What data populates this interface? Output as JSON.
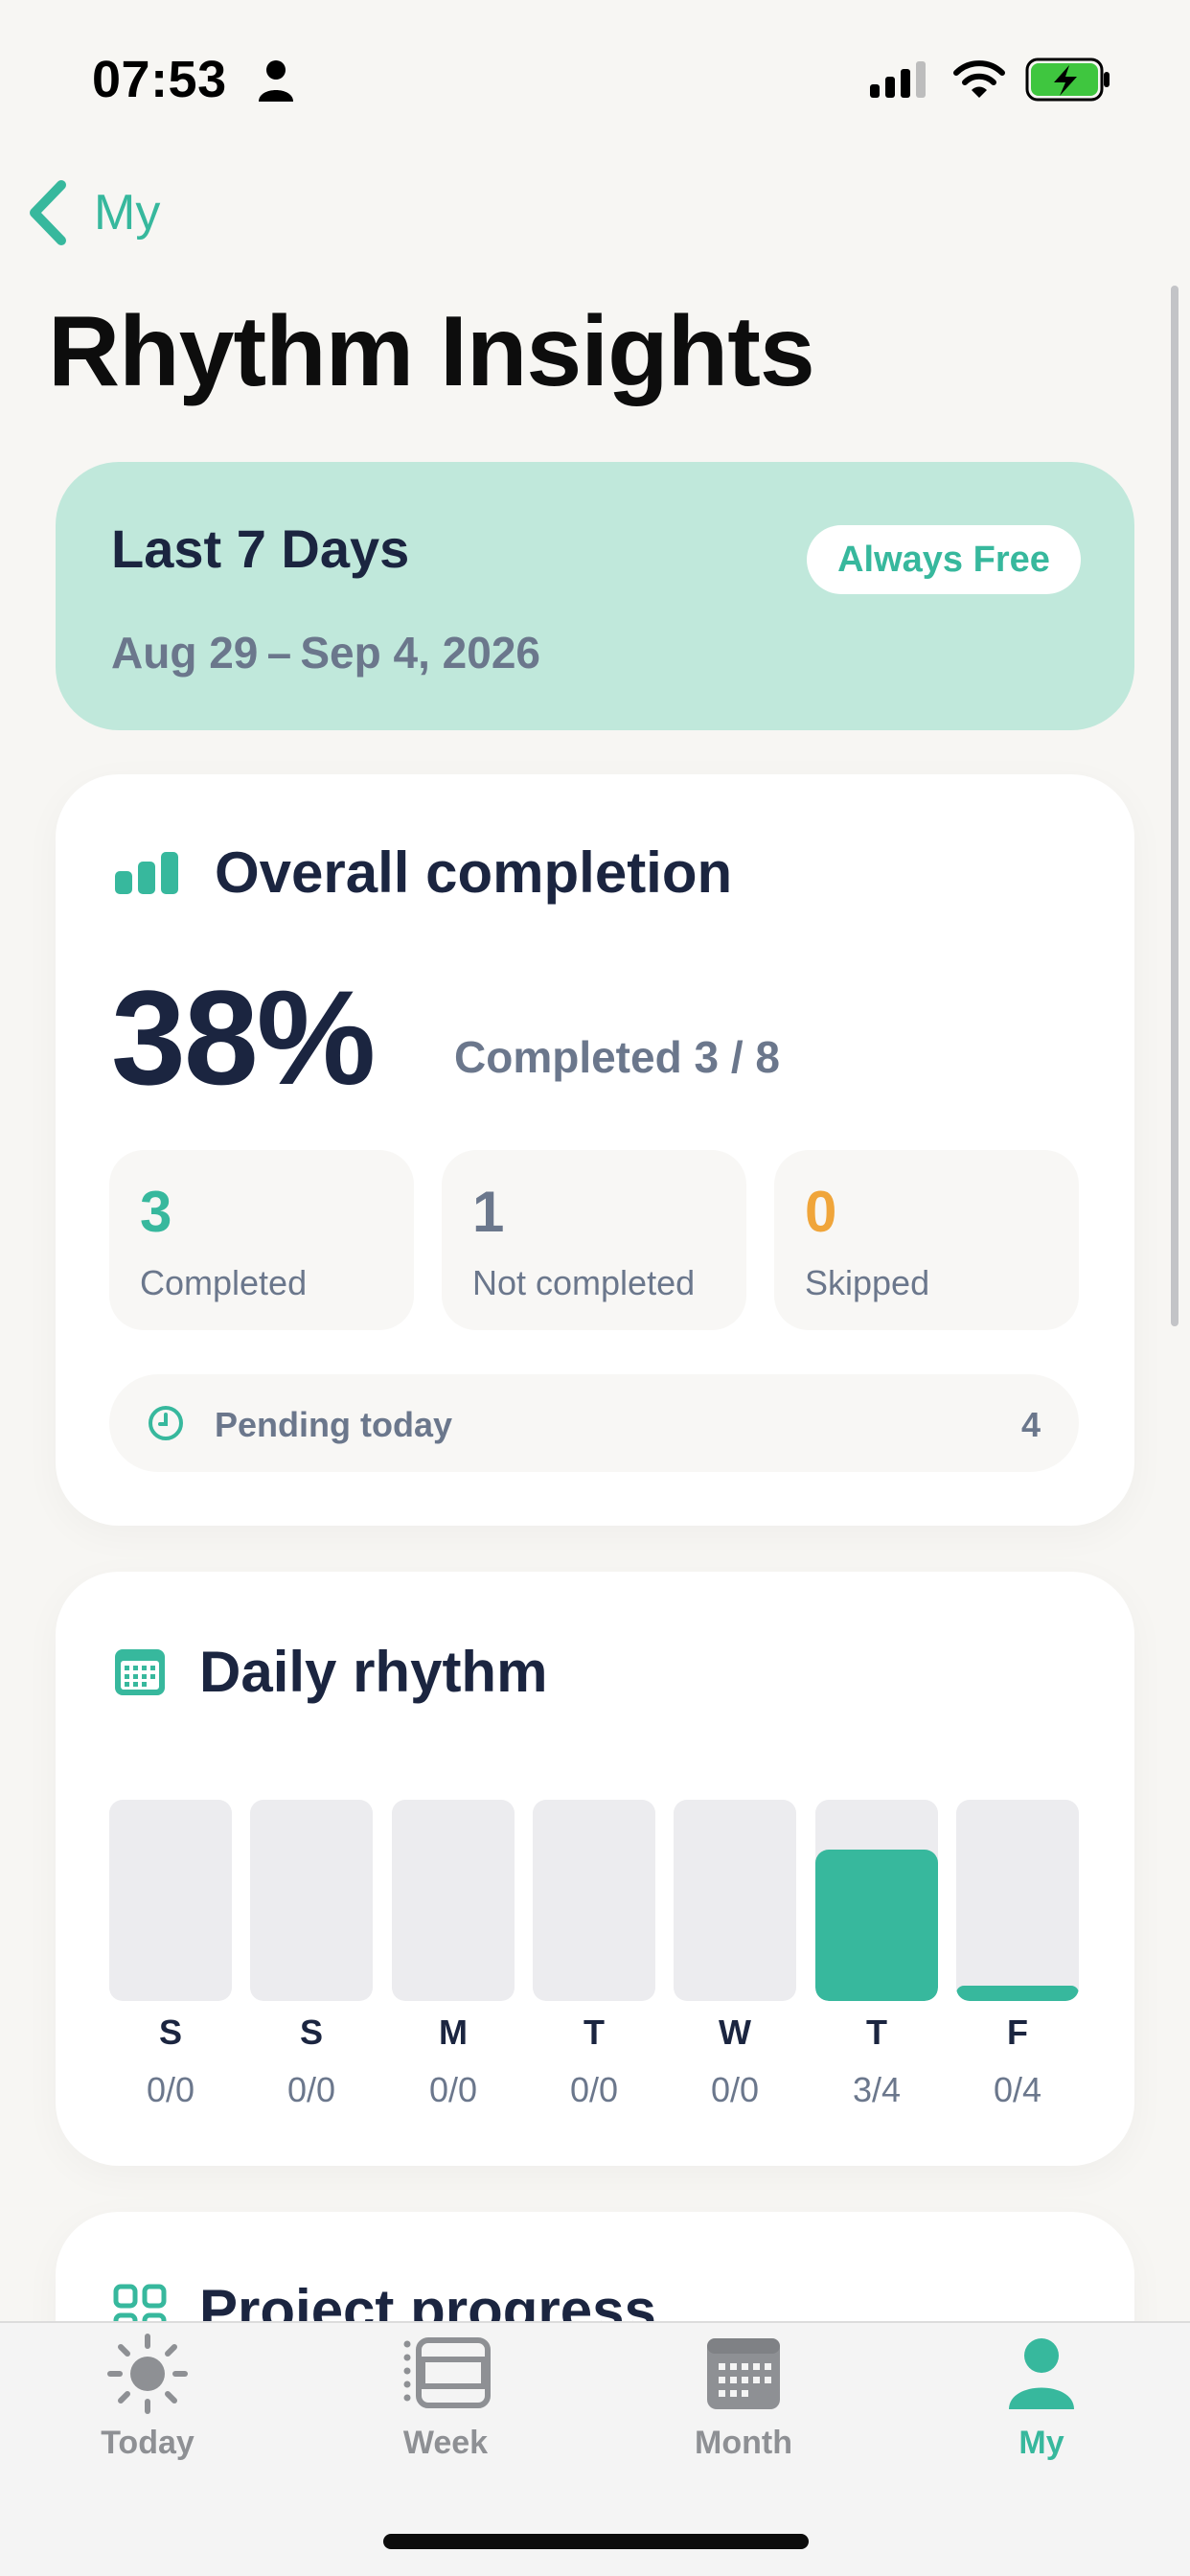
{
  "status_bar": {
    "time": "07:53"
  },
  "nav": {
    "back_label": "My",
    "title": "Rhythm Insights"
  },
  "range_card": {
    "title": "Last 7 Days",
    "dates": "Aug 29 – Sep 4, 2026",
    "badge": "Always Free"
  },
  "overall": {
    "heading": "Overall completion",
    "percent": "38%",
    "ratio": "Completed 3 / 8",
    "stats": [
      {
        "value": "3",
        "label": "Completed",
        "color": "#37b89d"
      },
      {
        "value": "1",
        "label": "Not completed",
        "color": "#6b778c"
      },
      {
        "value": "0",
        "label": "Skipped",
        "color": "#f0a53a"
      }
    ],
    "pending_label": "Pending today",
    "pending_value": "4"
  },
  "daily": {
    "heading": "Daily rhythm",
    "days": [
      {
        "day": "S",
        "ratio": "0/0",
        "fill": 0
      },
      {
        "day": "S",
        "ratio": "0/0",
        "fill": 0
      },
      {
        "day": "M",
        "ratio": "0/0",
        "fill": 0
      },
      {
        "day": "T",
        "ratio": "0/0",
        "fill": 0
      },
      {
        "day": "W",
        "ratio": "0/0",
        "fill": 0
      },
      {
        "day": "T",
        "ratio": "3/4",
        "fill": 0.75
      },
      {
        "day": "F",
        "ratio": "0/4",
        "fill": 0
      }
    ]
  },
  "project": {
    "heading": "Project progress"
  },
  "tabs": [
    {
      "label": "Today",
      "icon": "sun-icon",
      "active": false
    },
    {
      "label": "Week",
      "icon": "week-icon",
      "active": false
    },
    {
      "label": "Month",
      "icon": "calendar-icon",
      "active": false
    },
    {
      "label": "My",
      "icon": "person-icon",
      "active": true
    }
  ],
  "colors": {
    "accent": "#37b89d",
    "range_card_bg": "#c0e8db",
    "text_dark": "#1b2540",
    "text_muted": "#6b778c",
    "skipped": "#f0a53a"
  }
}
